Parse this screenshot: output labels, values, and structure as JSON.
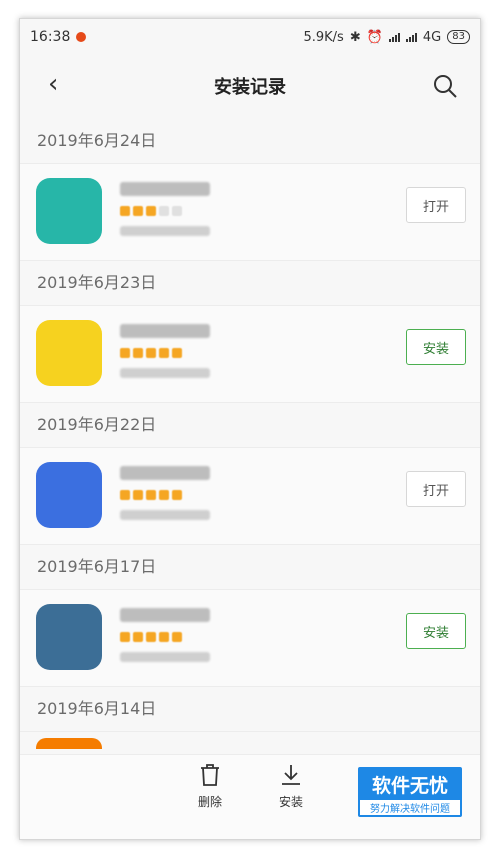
{
  "status_bar": {
    "time": "16:38",
    "network_speed": "5.9K/s",
    "network_type": "4G",
    "battery": "83"
  },
  "header": {
    "title": "安装记录"
  },
  "groups": [
    {
      "date": "2019年6月24日",
      "app": {
        "button": "打开",
        "button_style": "gray",
        "icon_color": "#27b6a8",
        "rating": 3
      }
    },
    {
      "date": "2019年6月23日",
      "app": {
        "button": "安装",
        "button_style": "green",
        "icon_color": "#f6d21f",
        "rating": 5
      }
    },
    {
      "date": "2019年6月22日",
      "app": {
        "button": "打开",
        "button_style": "gray",
        "icon_color": "#3b6fe0",
        "rating": 5
      }
    },
    {
      "date": "2019年6月17日",
      "app": {
        "button": "安装",
        "button_style": "green",
        "icon_color": "#3c6e96",
        "rating": 5
      }
    },
    {
      "date": "2019年6月14日"
    }
  ],
  "toolbar": {
    "delete_label": "删除",
    "install_label": "安装"
  },
  "watermark": {
    "title": "软件无忧",
    "subtitle": "努力解决软件问题"
  }
}
